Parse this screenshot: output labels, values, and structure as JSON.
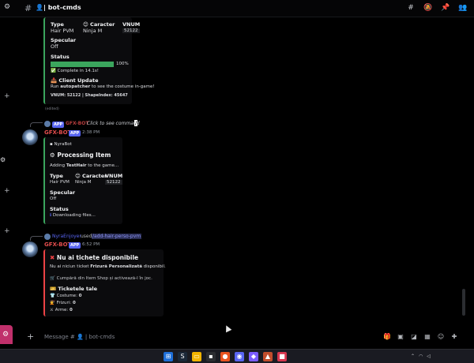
{
  "header": {
    "channel_icon": "person-icon",
    "channel_name": "| bot-cmds",
    "icons": [
      "threads-icon",
      "mute-icon",
      "pin-icon",
      "members-icon"
    ]
  },
  "first_embed": {
    "rows": [
      {
        "label": "Type",
        "value": "Hair PVM"
      },
      {
        "label": "Caracter",
        "value": "Ninja M",
        "icon": "face-icon"
      },
      {
        "label": "VNUM",
        "value": "52122"
      }
    ],
    "specular_label": "Specular",
    "specular_value": "Off",
    "status_label": "Status",
    "progress_percent": 100,
    "progress_text": "100%",
    "complete_text": "Complete in 14.1s!",
    "client_update_label": "Client Update",
    "run_prefix": "Run ",
    "run_command": "autopatcher",
    "run_suffix": " to see the costume in-game!",
    "footer": "VNUM: 52122 | ShapeIndex: 45647",
    "edited": "(edited)"
  },
  "second_message": {
    "reply_badge": "APP",
    "reply_bot": "GFX-BOT",
    "reply_text": "Click to see command",
    "bot_name": "GFX-BOT",
    "badge": "APP",
    "time": "2:38 PM",
    "embed": {
      "author": "NyraBot",
      "title": "Processing Item",
      "adding_prefix": "Adding ",
      "adding_item": "TestHair",
      "adding_suffix": " to the game...",
      "type_label": "Type",
      "type_value": "Hair PVM",
      "caracter_label": "Caracter",
      "caracter_value": "Ninja M",
      "vnum_label": "VNUM",
      "vnum_value": "52122",
      "specular_label": "Specular",
      "specular_value": "Off",
      "status_label": "Status",
      "status_value": "Downloading files..."
    }
  },
  "third_message": {
    "reply_user": "NyraEnjoyer",
    "reply_used": "used",
    "reply_command": "/add-hair-perso-pvm",
    "bot_name": "GFX-BOT",
    "badge": "APP",
    "time": "6:52 PM",
    "embed": {
      "title": "Nu ai tichete disponibile",
      "line_prefix": "Nu ai niciun ticket ",
      "line_bold": "Frizură Personalizată",
      "line_suffix": " disponibil.",
      "shop_text": "Cumpără din Item Shop și activează-l în joc.",
      "tickets_title": "Ticketele tale",
      "tickets": [
        {
          "label": "Costume:",
          "value": "0"
        },
        {
          "label": "Frizuri:",
          "value": "0"
        },
        {
          "label": "Arme:",
          "value": "0"
        }
      ]
    }
  },
  "composer": {
    "placeholder": "Message # 👤 | bot-cmds"
  },
  "colors": {
    "accent_green": "#3ba55d",
    "error_red": "#ed4245",
    "bot_name": "#e34d4d",
    "app_badge": "#5865f2"
  }
}
